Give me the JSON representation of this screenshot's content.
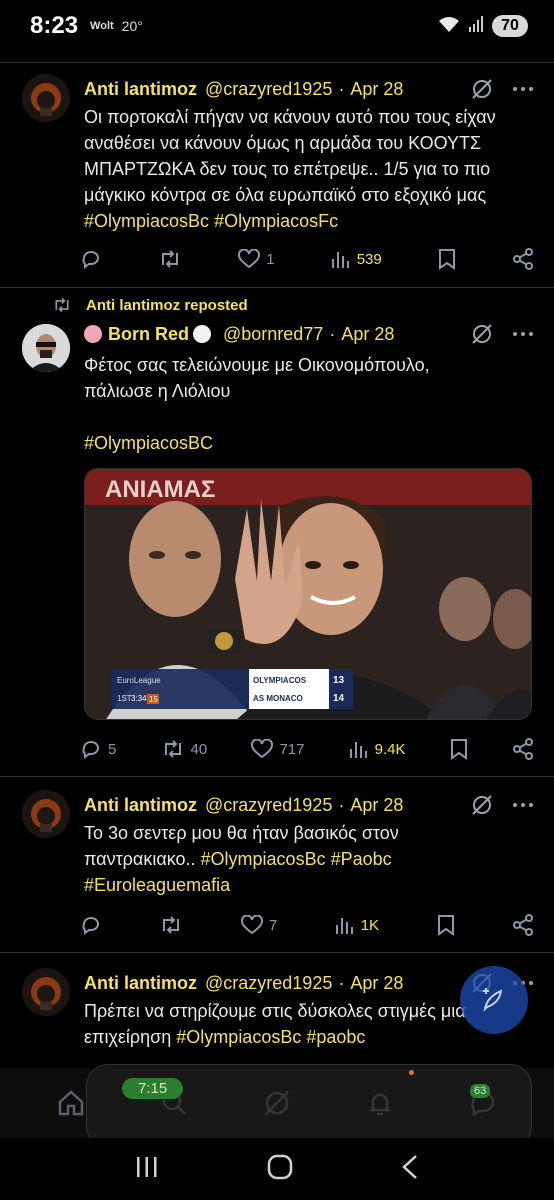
{
  "status_bar": {
    "time": "8:23",
    "app_icon": "Wolt",
    "temperature": "20°",
    "battery": "70"
  },
  "tweets": [
    {
      "name": "Anti lantimoz",
      "handle": "@crazyred1925",
      "date": "Apr 28",
      "text": "Οι πορτοκαλί πήγαν να κάνουν αυτό που τους είχαν αναθέσει να κάνουν όμως η αρμάδα του ΚΟΟΥΤΣ ΜΠΑΡΤΖΩΚΑ δεν τους το επέτρεψε.. 1/5 για το πιο μάγκικο κόντρα σε όλα ευρωπαϊκό στο εξοχικό μας ",
      "hashtags": [
        "#OlympiacosBc",
        "#OlympiacosFc"
      ],
      "replies": "",
      "reposts": "",
      "likes": "1",
      "views": "539"
    },
    {
      "repost_label": "Anti lantimoz reposted",
      "name": "Born Red",
      "handle": "@bornred77",
      "date": "Apr 28",
      "text_line1": "Φέτος σας τελειώνουμε με Οικονομόπουλο,",
      "text_line2": "πάλιωσε η Λιόλιου",
      "hashtag": "#OlympiacosBC",
      "replies": "5",
      "reposts": "40",
      "likes": "717",
      "views": "9.4K",
      "media": {
        "scoreboard": {
          "league": "EuroLeague",
          "period": "1ST",
          "clock": "3:34",
          "shot_clock": "15",
          "team1": "OLYMPIACOS",
          "score1": "13",
          "team2": "AS MONACO",
          "score2": "14"
        },
        "banner_text": "ANIAMAΣ"
      }
    },
    {
      "name": "Anti lantimoz",
      "handle": "@crazyred1925",
      "date": "Apr 28",
      "text": "Το 3ο σεντερ μου θα ήταν βασικός στον παντρακιακο.. ",
      "hashtags": [
        "#OlympiacosBc",
        "#Paobc",
        "#Euroleaguemafia"
      ],
      "replies": "",
      "reposts": "",
      "likes": "7",
      "views": "1K"
    },
    {
      "name": "Anti lantimoz",
      "handle": "@crazyred1925",
      "date": "Apr 28",
      "text": "Πρέπει να στηρίζουμε στις δύσκολες στιγμές μια επιχείρηση ",
      "hashtags": [
        "#OlympiacosBc",
        "#paobc"
      ]
    }
  ],
  "pip": {
    "time": "7:15",
    "battery": "63"
  },
  "colors": {
    "accent": "#f5e063",
    "background": "#000000",
    "divider": "#2f3336",
    "muted": "#8b98a5"
  },
  "icons": [
    "wifi-icon",
    "signal-icon",
    "grok-icon",
    "more-icon",
    "reply-icon",
    "repost-icon",
    "like-icon",
    "views-icon",
    "bookmark-icon",
    "share-icon",
    "home-icon",
    "search-icon",
    "notifications-icon",
    "messages-icon",
    "compose-icon"
  ]
}
